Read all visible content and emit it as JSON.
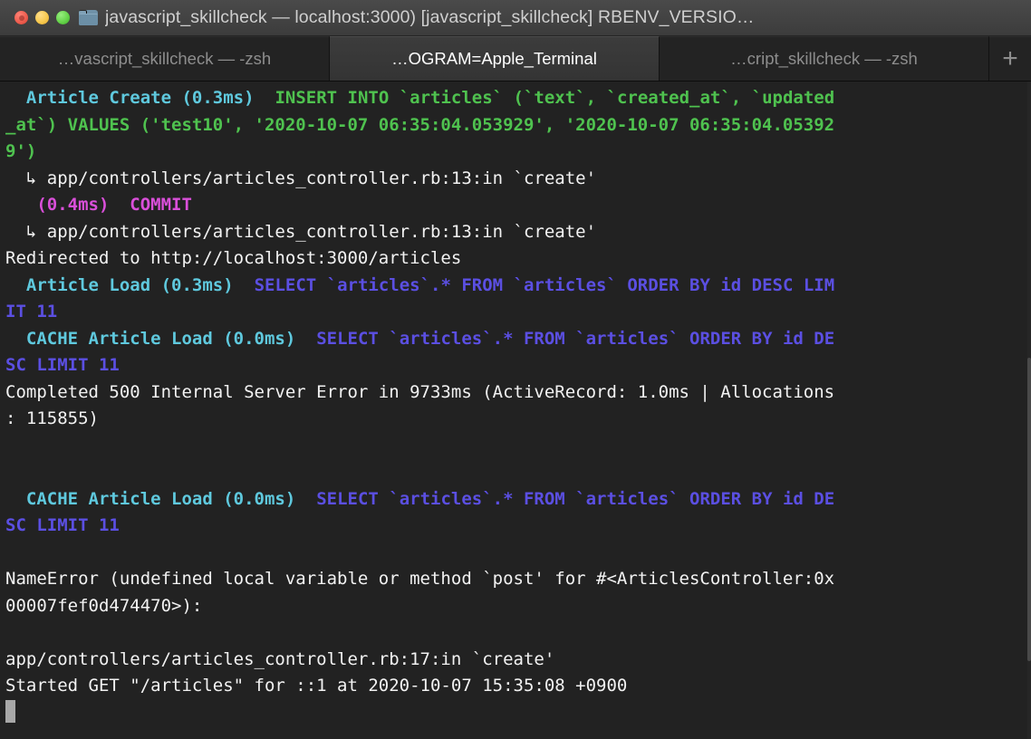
{
  "window": {
    "title": "javascript_skillcheck — localhost:3000) [javascript_skillcheck] RBENV_VERSIO…",
    "folder_icon": "folder-icon",
    "close_button": "close-button",
    "minimize_button": "minimize-button",
    "zoom_button": "zoom-button"
  },
  "tabs": [
    {
      "label": "…vascript_skillcheck — -zsh",
      "active": false
    },
    {
      "label": "…OGRAM=Apple_Terminal",
      "active": true
    },
    {
      "label": "…cript_skillcheck — -zsh",
      "active": false
    }
  ],
  "new_tab_label": "+",
  "colors": {
    "background": "#222222",
    "foreground": "#f2f2f2",
    "cyan": "#5fc9de",
    "green": "#4fc24f",
    "magenta": "#d94fd9",
    "purple": "#5b4fe2",
    "titlebar": "#3c3c3c",
    "tab_active": "#3a3a3a",
    "tab_inactive": "#232323"
  },
  "terminal": {
    "lines": [
      {
        "id": "line-01",
        "segments": [
          {
            "text": "  ",
            "color": "white"
          },
          {
            "text": "Article Create (0.3ms)",
            "color": "cyan"
          },
          {
            "text": "  ",
            "color": "white"
          },
          {
            "text": "INSERT INTO `articles` (`text`, `created_at`, `updated",
            "color": "green"
          }
        ]
      },
      {
        "id": "line-02",
        "segments": [
          {
            "text": "_at`) VALUES ('test10', '2020-10-07 06:35:04.053929', '2020-10-07 06:35:04.05392",
            "color": "green"
          }
        ]
      },
      {
        "id": "line-03",
        "segments": [
          {
            "text": "9')",
            "color": "green"
          }
        ]
      },
      {
        "id": "line-04",
        "segments": [
          {
            "text": "  ↳ app/controllers/articles_controller.rb:13:in `create'",
            "color": "white"
          }
        ]
      },
      {
        "id": "line-05",
        "segments": [
          {
            "text": "   ",
            "color": "white"
          },
          {
            "text": "(0.4ms)  COMMIT",
            "color": "magenta"
          }
        ]
      },
      {
        "id": "line-06",
        "segments": [
          {
            "text": "  ↳ app/controllers/articles_controller.rb:13:in `create'",
            "color": "white"
          }
        ]
      },
      {
        "id": "line-07",
        "segments": [
          {
            "text": "Redirected to http://localhost:3000/articles",
            "color": "white"
          }
        ]
      },
      {
        "id": "line-08",
        "segments": [
          {
            "text": "  ",
            "color": "white"
          },
          {
            "text": "Article Load (0.3ms)",
            "color": "cyan"
          },
          {
            "text": "  ",
            "color": "white"
          },
          {
            "text": "SELECT `articles`.* FROM `articles` ORDER BY id DESC LIM",
            "color": "purple"
          }
        ]
      },
      {
        "id": "line-09",
        "segments": [
          {
            "text": "IT 11",
            "color": "purple"
          }
        ]
      },
      {
        "id": "line-10",
        "segments": [
          {
            "text": "  ",
            "color": "white"
          },
          {
            "text": "CACHE Article Load (0.0ms)",
            "color": "cyan"
          },
          {
            "text": "  ",
            "color": "white"
          },
          {
            "text": "SELECT `articles`.* FROM `articles` ORDER BY id DE",
            "color": "purple"
          }
        ]
      },
      {
        "id": "line-11",
        "segments": [
          {
            "text": "SC LIMIT 11",
            "color": "purple"
          }
        ]
      },
      {
        "id": "line-12",
        "segments": [
          {
            "text": "Completed 500 Internal Server Error in 9733ms (ActiveRecord: 1.0ms | Allocations",
            "color": "white"
          }
        ]
      },
      {
        "id": "line-13",
        "segments": [
          {
            "text": ": 115855)",
            "color": "white"
          }
        ]
      },
      {
        "id": "line-14",
        "segments": [
          {
            "text": "",
            "color": "white"
          }
        ]
      },
      {
        "id": "line-15",
        "segments": [
          {
            "text": "",
            "color": "white"
          }
        ]
      },
      {
        "id": "line-16",
        "segments": [
          {
            "text": "  ",
            "color": "white"
          },
          {
            "text": "CACHE Article Load (0.0ms)",
            "color": "cyan"
          },
          {
            "text": "  ",
            "color": "white"
          },
          {
            "text": "SELECT `articles`.* FROM `articles` ORDER BY id DE",
            "color": "purple"
          }
        ]
      },
      {
        "id": "line-17",
        "segments": [
          {
            "text": "SC LIMIT 11",
            "color": "purple"
          }
        ]
      },
      {
        "id": "line-18",
        "segments": [
          {
            "text": "",
            "color": "white"
          }
        ]
      },
      {
        "id": "line-19",
        "segments": [
          {
            "text": "NameError (undefined local variable or method `post' for #<ArticlesController:0x",
            "color": "white"
          }
        ]
      },
      {
        "id": "line-20",
        "segments": [
          {
            "text": "00007fef0d474470>):",
            "color": "white"
          }
        ]
      },
      {
        "id": "line-21",
        "segments": [
          {
            "text": "",
            "color": "white"
          }
        ]
      },
      {
        "id": "line-22",
        "segments": [
          {
            "text": "app/controllers/articles_controller.rb:17:in `create'",
            "color": "white"
          }
        ]
      },
      {
        "id": "line-23",
        "segments": [
          {
            "text": "Started GET \"/articles\" for ::1 at 2020-10-07 15:35:08 +0900",
            "color": "white"
          }
        ]
      },
      {
        "id": "line-24",
        "cursor": true,
        "segments": []
      }
    ]
  }
}
